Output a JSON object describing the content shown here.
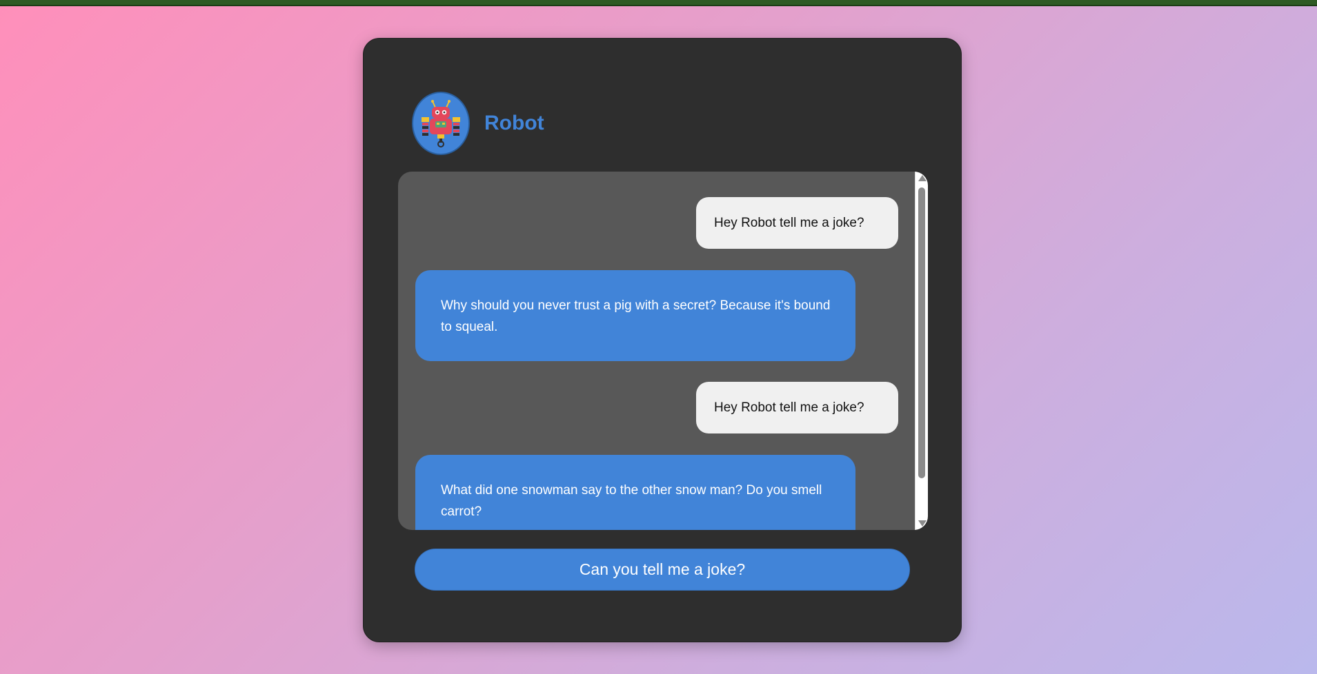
{
  "header": {
    "robot_name": "Robot",
    "avatar_icon": "robot-icon"
  },
  "messages": [
    {
      "sender": "user",
      "text": "Hey Robot tell me a joke?"
    },
    {
      "sender": "bot",
      "text": "Why should you never trust a pig with a secret? Because it's bound to squeal."
    },
    {
      "sender": "user",
      "text": "Hey Robot tell me a joke?"
    },
    {
      "sender": "bot",
      "text": "What did one snowman say to the other snow man? Do you smell carrot?"
    }
  ],
  "actions": {
    "joke_button_label": "Can you tell me a joke?"
  },
  "colors": {
    "accent": "#4184d8",
    "card_background": "#2e2e2e",
    "chat_background": "#585858",
    "user_bubble": "#f0f0f0"
  }
}
